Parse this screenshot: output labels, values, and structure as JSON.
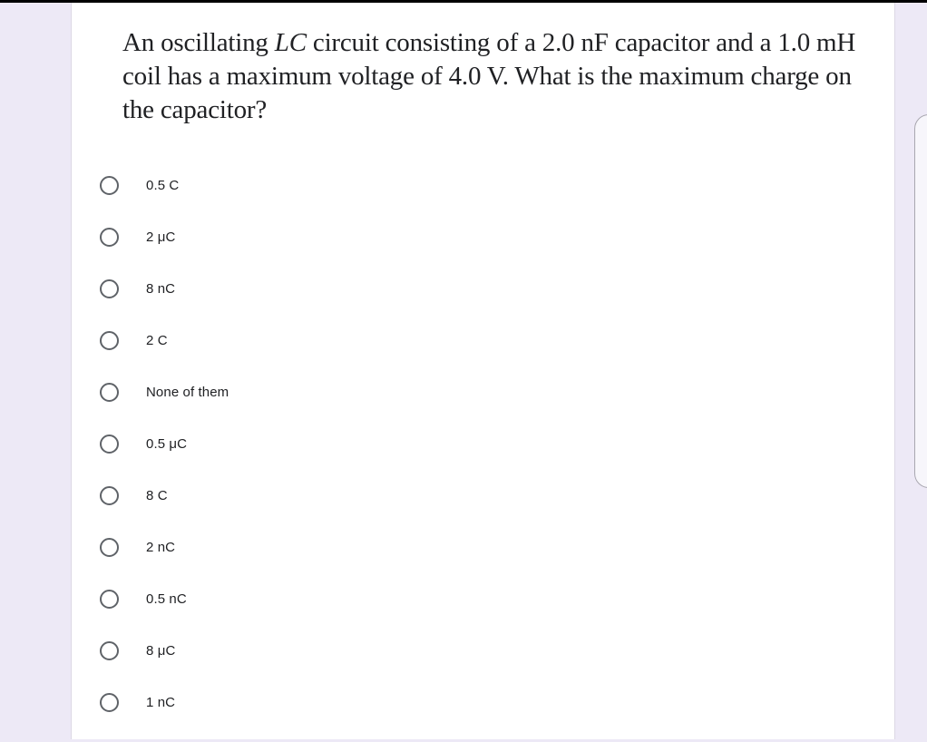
{
  "question": {
    "parts": [
      {
        "text": "An oscillating ",
        "italic": false
      },
      {
        "text": "LC",
        "italic": true
      },
      {
        "text": " circuit consisting of a 2.0 nF capacitor and a 1.0 mH coil has a maximum voltage of 4.0 V. What is the maximum charge on the capacitor?",
        "italic": false
      }
    ]
  },
  "options": [
    {
      "label": "0.5 C",
      "selected": false
    },
    {
      "label": "2 μC",
      "selected": false
    },
    {
      "label": "8 nC",
      "selected": false
    },
    {
      "label": "2 C",
      "selected": false
    },
    {
      "label": "None of them",
      "selected": false
    },
    {
      "label": "0.5 μC",
      "selected": false
    },
    {
      "label": "8 C",
      "selected": false
    },
    {
      "label": "2 nC",
      "selected": false
    },
    {
      "label": "0.5 nC",
      "selected": false
    },
    {
      "label": "8 μC",
      "selected": false
    },
    {
      "label": "1 nC",
      "selected": false
    }
  ],
  "colors": {
    "page_background": "#ede9f6",
    "card_background": "#ffffff",
    "text": "#202124",
    "radio_border": "#5f6368"
  }
}
